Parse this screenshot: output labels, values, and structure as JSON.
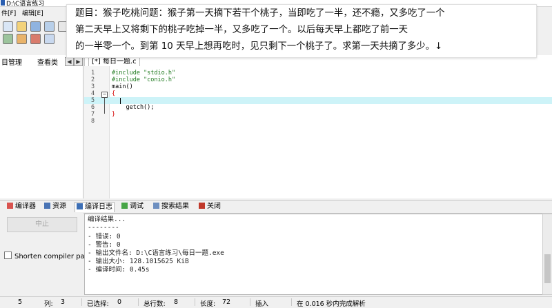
{
  "window": {
    "title": "D:\\C语言练习"
  },
  "menu": {
    "file": "件[F]",
    "edit": "编辑[E]"
  },
  "left_panel": {
    "tab_project": "目管理",
    "tab_classes": "查看类"
  },
  "editor": {
    "file_tab": "[*] 每日一题.c",
    "lines": [
      {
        "num": "1",
        "code": "#include \"stdio.h\""
      },
      {
        "num": "2",
        "code": "#include \"conio.h\""
      },
      {
        "num": "3",
        "code": "main()"
      },
      {
        "num": "4",
        "code": "{"
      },
      {
        "num": "5",
        "code": ""
      },
      {
        "num": "6",
        "code": "    getch();"
      },
      {
        "num": "7",
        "code": "}"
      },
      {
        "num": "8",
        "code": ""
      }
    ]
  },
  "problem": {
    "line1": "题目：猴子吃桃问题：猴子第一天摘下若干个桃子，当即吃了一半，还不瘾，又多吃了一个",
    "line2": "第二天早上又将剩下的桃子吃掉一半，又多吃了一个。以后每天早上都吃了前一天",
    "line3": "的一半零一个。到第 10 天早上想再吃时，见只剩下一个桃子了。求第一天共摘了多少。↓"
  },
  "bottom_tabs": {
    "compiler": "编译器",
    "resources": "资源",
    "compile_log": "编译日志",
    "debug": "调试",
    "search_results": "搜索结果",
    "close": "关闭"
  },
  "compile_panel": {
    "stop_button": "中止",
    "shorten_paths_label": "Shorten compiler paths"
  },
  "compile_log": {
    "lines": [
      "编译结果...",
      "--------",
      "- 错误: 0",
      "- 警告: 0",
      "- 输出文件名: D:\\C语言练习\\每日一题.exe",
      "- 输出大小: 128.1015625 KiB",
      "- 编译时间: 0.45s"
    ]
  },
  "status": {
    "line_value": "5",
    "col_label": "列:",
    "col_value": "3",
    "selected_label": "已选择:",
    "selected_value": "0",
    "total_lines_label": "总行数:",
    "total_lines_value": "8",
    "length_label": "长度:",
    "length_value": "72",
    "mode": "插入",
    "parse_info": "在 0.016 秒内完成解析"
  },
  "colors": {
    "current_line": "#cdf3f8",
    "preprocessor": "#1f7a1f",
    "brace": "#d40000"
  }
}
